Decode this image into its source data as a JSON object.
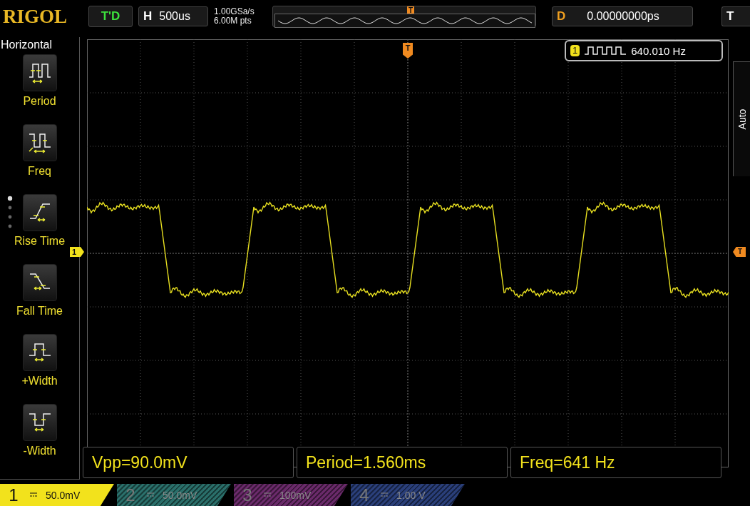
{
  "top_bar": {
    "logo": "RIGOL",
    "run_status": "T'D",
    "timebase": {
      "label": "H",
      "value": "500us"
    },
    "sample_rate": "1.00GSa/s",
    "memory_depth": "6.00M pts",
    "trigger_position": "T",
    "delay": {
      "label": "D",
      "value": "0.00000000ps"
    },
    "trigger": {
      "label": "T"
    }
  },
  "menu": {
    "title": "Horizontal",
    "items": [
      {
        "kind": "period",
        "label": "Period"
      },
      {
        "kind": "freq",
        "label": "Freq"
      },
      {
        "kind": "rise",
        "label": "Rise Time"
      },
      {
        "kind": "fall",
        "label": "Fall Time"
      },
      {
        "kind": "pwidth",
        "label": "+Width"
      },
      {
        "kind": "nwidth",
        "label": "-Width"
      }
    ]
  },
  "markers": {
    "trigger_position": "T",
    "channel": "1",
    "trigger_level": "T"
  },
  "counter": {
    "channel": "1",
    "value": "640.010 Hz"
  },
  "side_label": "Auto",
  "measurements": [
    "Vpp=90.0mV",
    "Period=1.560ms",
    "Freq=641 Hz"
  ],
  "channels": [
    {
      "number": "1",
      "scale": "50.0mV",
      "selected": true,
      "color": "#f2e21c"
    },
    {
      "number": "2",
      "scale": "50.0mV",
      "selected": false,
      "color": "#2a6f6a"
    },
    {
      "number": "3",
      "scale": "100mV",
      "selected": false,
      "color": "#6a2a6a"
    },
    {
      "number": "4",
      "scale": "1.00 V",
      "selected": false,
      "color": "#2a3f7a"
    }
  ]
}
